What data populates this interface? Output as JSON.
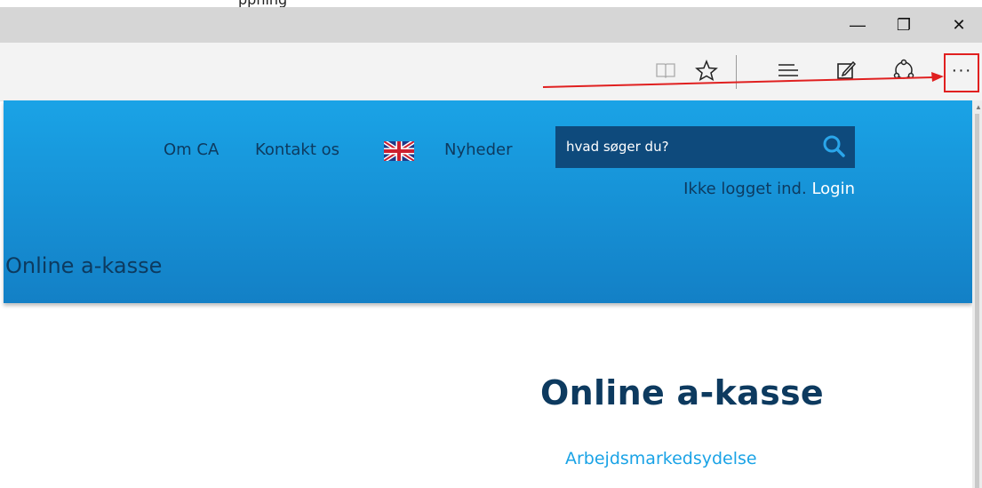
{
  "window": {
    "caption_fragment": "ppning"
  },
  "titlebar": {
    "minimize_glyph": "—",
    "restore_glyph": "❐",
    "close_glyph": "✕"
  },
  "toolbar": {
    "icons": [
      "reading-view-icon",
      "favorite-star-icon",
      "hub-icon",
      "web-note-icon",
      "share-icon",
      "more-icon"
    ],
    "more_label": "···",
    "highlight_color": "#e02020"
  },
  "site": {
    "nav": {
      "om_ca": "Om CA",
      "kontakt": "Kontakt os",
      "nyheder": "Nyheder"
    },
    "search": {
      "placeholder": "hvad søger du?"
    },
    "login_status": "Ikke logget ind.",
    "login_link": "Login",
    "header_title": "Online a-kasse",
    "colors": {
      "header_top": "#1aa3e6",
      "header_bottom": "#1380c6",
      "dark_text": "#0d3a5f",
      "search_bg": "#0e4a7c"
    }
  },
  "main": {
    "title": "Online a-kasse",
    "link": "Arbejdsmarkedsydelse"
  }
}
